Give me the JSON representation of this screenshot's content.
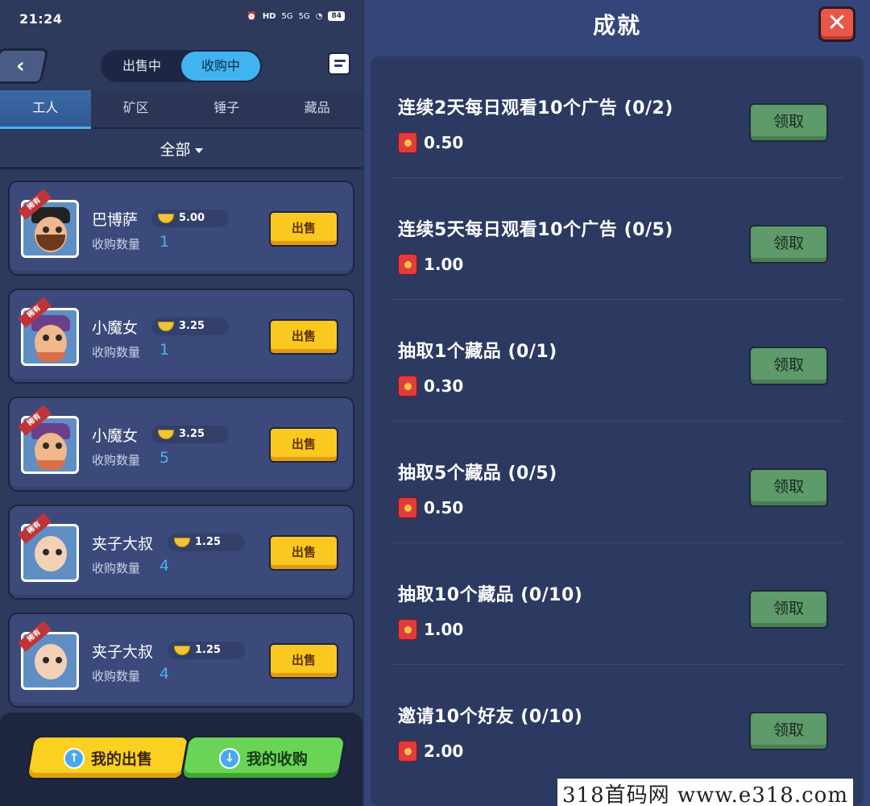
{
  "status_bar": {
    "time": "21:24",
    "battery": "84",
    "signal1": "5G",
    "signal2": "5G",
    "hd": "HD"
  },
  "market": {
    "toggle": [
      "出售中",
      "收购中"
    ],
    "active_toggle": "收购中",
    "tabs": [
      "工人",
      "矿区",
      "锤子",
      "藏品"
    ],
    "active_tab": "工人",
    "filter": "全部",
    "rare_badge": "稀有",
    "qty_label": "收购数量",
    "sell_label": "出售",
    "items": [
      {
        "name": "巴博萨",
        "price": "5.00",
        "qty": "1"
      },
      {
        "name": "小魔女",
        "price": "3.25",
        "qty": "1"
      },
      {
        "name": "小魔女",
        "price": "3.25",
        "qty": "5"
      },
      {
        "name": "夹子大叔",
        "price": "1.25",
        "qty": "4"
      },
      {
        "name": "夹子大叔",
        "price": "1.25",
        "qty": "4"
      }
    ],
    "bottom": {
      "my_sale": "我的出售",
      "my_buy": "我的收购"
    }
  },
  "achievements": {
    "title": "成就",
    "close": "✕",
    "claim_label": "领取",
    "items": [
      {
        "task": "连续2天每日观看10个广告 (0/2)",
        "reward": "0.50"
      },
      {
        "task": "连续5天每日观看10个广告 (0/5)",
        "reward": "1.00"
      },
      {
        "task": "抽取1个藏品 (0/1)",
        "reward": "0.30"
      },
      {
        "task": "抽取5个藏品 (0/5)",
        "reward": "0.50"
      },
      {
        "task": "抽取10个藏品 (0/10)",
        "reward": "1.00"
      },
      {
        "task": "邀请10个好友 (0/10)",
        "reward": "2.00"
      }
    ]
  },
  "watermark": "318首码网  www.e318.com",
  "colors": {
    "accent": "#3fb4f0",
    "gold_button": "#fbc81f",
    "claim_button": "#5e9a6a",
    "close_button": "#e8574a"
  }
}
